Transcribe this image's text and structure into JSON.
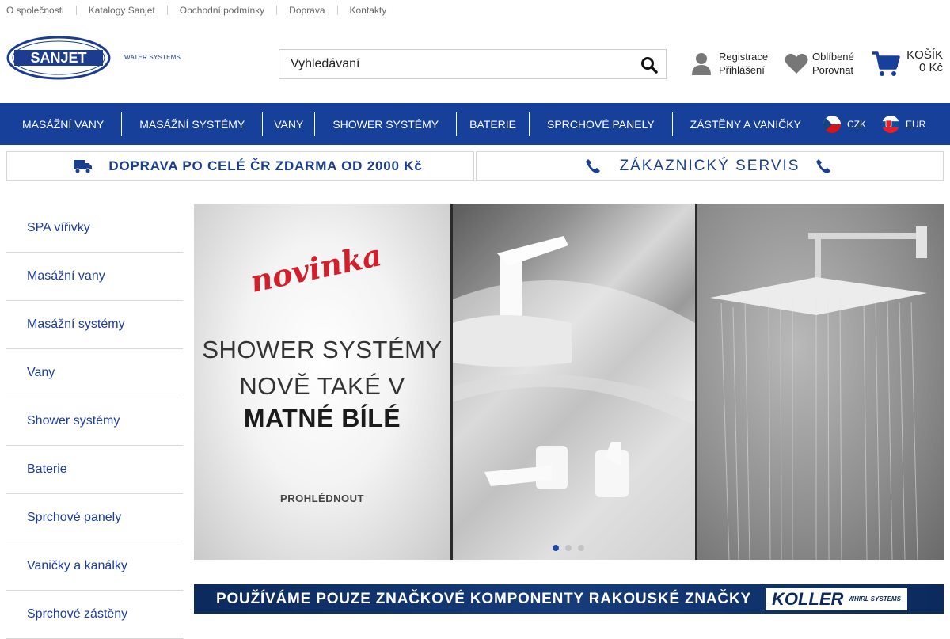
{
  "top_links": [
    "O společnosti",
    "Katalogy Sanjet",
    "Obchodní podmínky",
    "Doprava",
    "Kontakty"
  ],
  "logo": {
    "text": "SANJET",
    "tagline": "WATER SYSTEMS"
  },
  "search": {
    "placeholder": "Vyhledávaní"
  },
  "account": {
    "register": "Registrace",
    "login": "Přihlášení"
  },
  "favorites": {
    "favorites": "Oblíbené",
    "compare": "Porovnat"
  },
  "cart": {
    "label": "KOŠÍK",
    "total": "0 Kč"
  },
  "nav": {
    "items": [
      "MASÁŽNÍ VANY",
      "MASÁŽNÍ SYSTÉMY",
      "VANY",
      "SHOWER SYSTÉMY",
      "BATERIE",
      "SPRCHOVÉ PANELY",
      "ZÁSTĚNY A VANIČKY"
    ],
    "currencies": [
      "CZK",
      "EUR"
    ]
  },
  "promo": {
    "shipping": "DOPRAVA PO CELÉ ČR ZDARMA OD 2000 Kč",
    "service": "ZÁKAZNICKÝ SERVIS"
  },
  "sidebar": {
    "items": [
      "SPA vířivky",
      "Masážní vany",
      "Masážní systémy",
      "Vany",
      "Shower systémy",
      "Baterie",
      "Sprchové panely",
      "Vaničky a kanálky",
      "Sprchové zástěny"
    ]
  },
  "banner": {
    "badge": "novinka",
    "line1": "SHOWER SYSTÉMY",
    "line2": "NOVĚ TAKÉ V",
    "line3": "MATNÉ BÍLÉ",
    "cta": "PROHLÉDNOUT",
    "slide_count": 3,
    "active_slide": 1
  },
  "koller_banner": {
    "text": "POUŽÍVÁME POUZE ZNAČKOVÉ KOMPONENTY RAKOUSKÉ ZNAČKY",
    "brand": "KOLLER",
    "brand_sub": "WHIRL SYSTEMS"
  },
  "colors": {
    "brand_blue": "#16409a",
    "link_blue": "#1c3d9a",
    "accent_red": "#d21f2b"
  }
}
